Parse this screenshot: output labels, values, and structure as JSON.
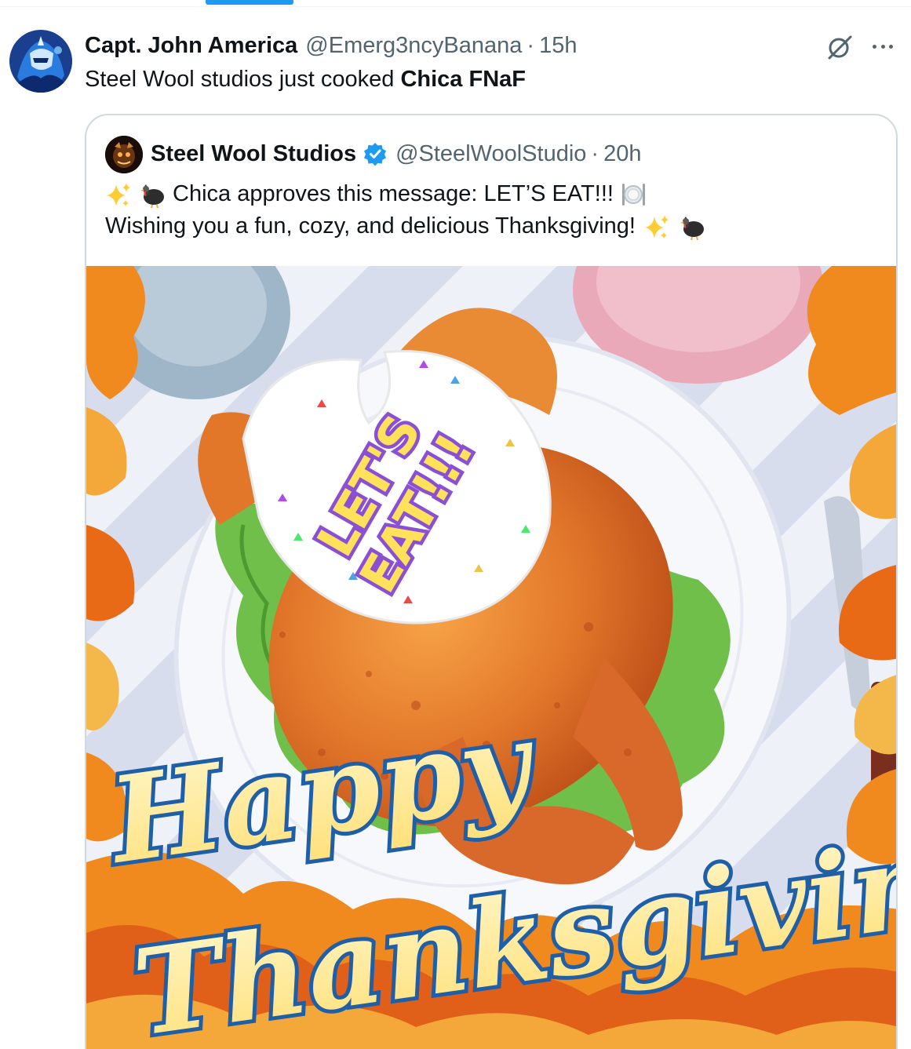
{
  "tweet": {
    "author": {
      "display_name": "Capt. John America",
      "handle": "@Emerg3ncyBanana",
      "time": "15h"
    },
    "separator": "·",
    "text_plain": "Steel Wool studios just cooked ",
    "text_bold": "Chica FNaF"
  },
  "quoted_tweet": {
    "author": {
      "display_name": "Steel Wool Studios",
      "handle": "@SteelWoolStudio",
      "time": "20h",
      "verified": true
    },
    "separator": "·",
    "line1": "Chica approves this message: LET’S EAT!!!",
    "line2": "Wishing you a fun, cozy, and delicious Thanksgiving!",
    "emojis": [
      "sparkles-icon",
      "turkey-icon",
      "plate-icon"
    ],
    "image": {
      "bib_text_line1": "LET'S",
      "bib_text_line2": "EAT!!!",
      "banner_line1": "Happy",
      "banner_line2": "Thanksgiving!"
    }
  },
  "colors": {
    "accent": "#1d9bf0",
    "text_primary": "#0f1419",
    "text_secondary": "#536471",
    "border": "#cfd9de"
  }
}
